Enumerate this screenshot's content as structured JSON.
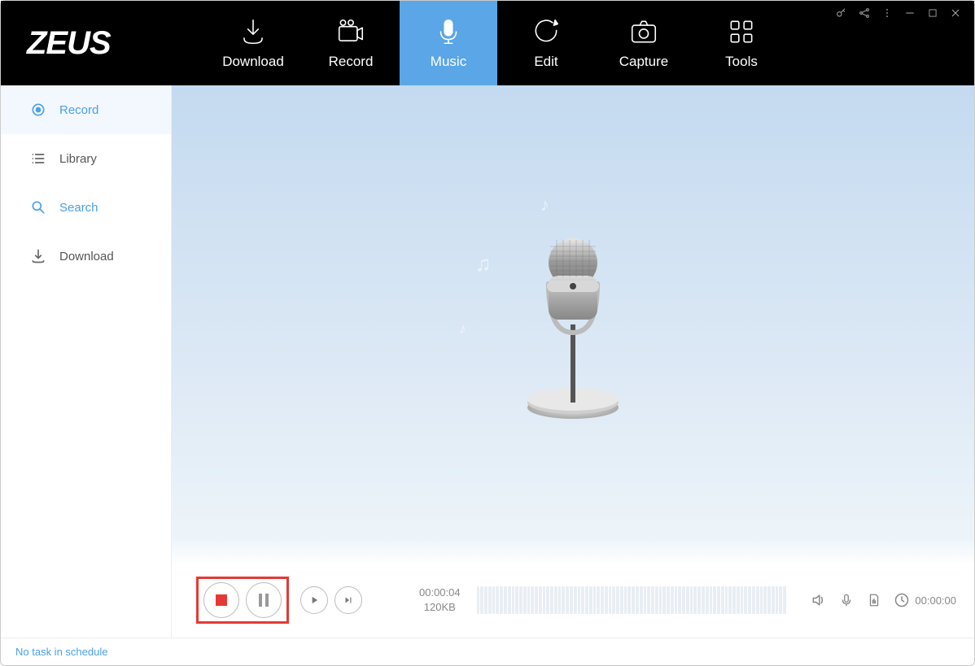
{
  "app": {
    "name": "ZEUS"
  },
  "topnav": {
    "download": "Download",
    "record": "Record",
    "music": "Music",
    "edit": "Edit",
    "capture": "Capture",
    "tools": "Tools"
  },
  "sidebar": {
    "record": "Record",
    "library": "Library",
    "search": "Search",
    "download": "Download"
  },
  "controls": {
    "elapsed": "00:00:04",
    "size": "120KB",
    "clock": "00:00:00"
  },
  "status": {
    "text": "No task in schedule"
  }
}
